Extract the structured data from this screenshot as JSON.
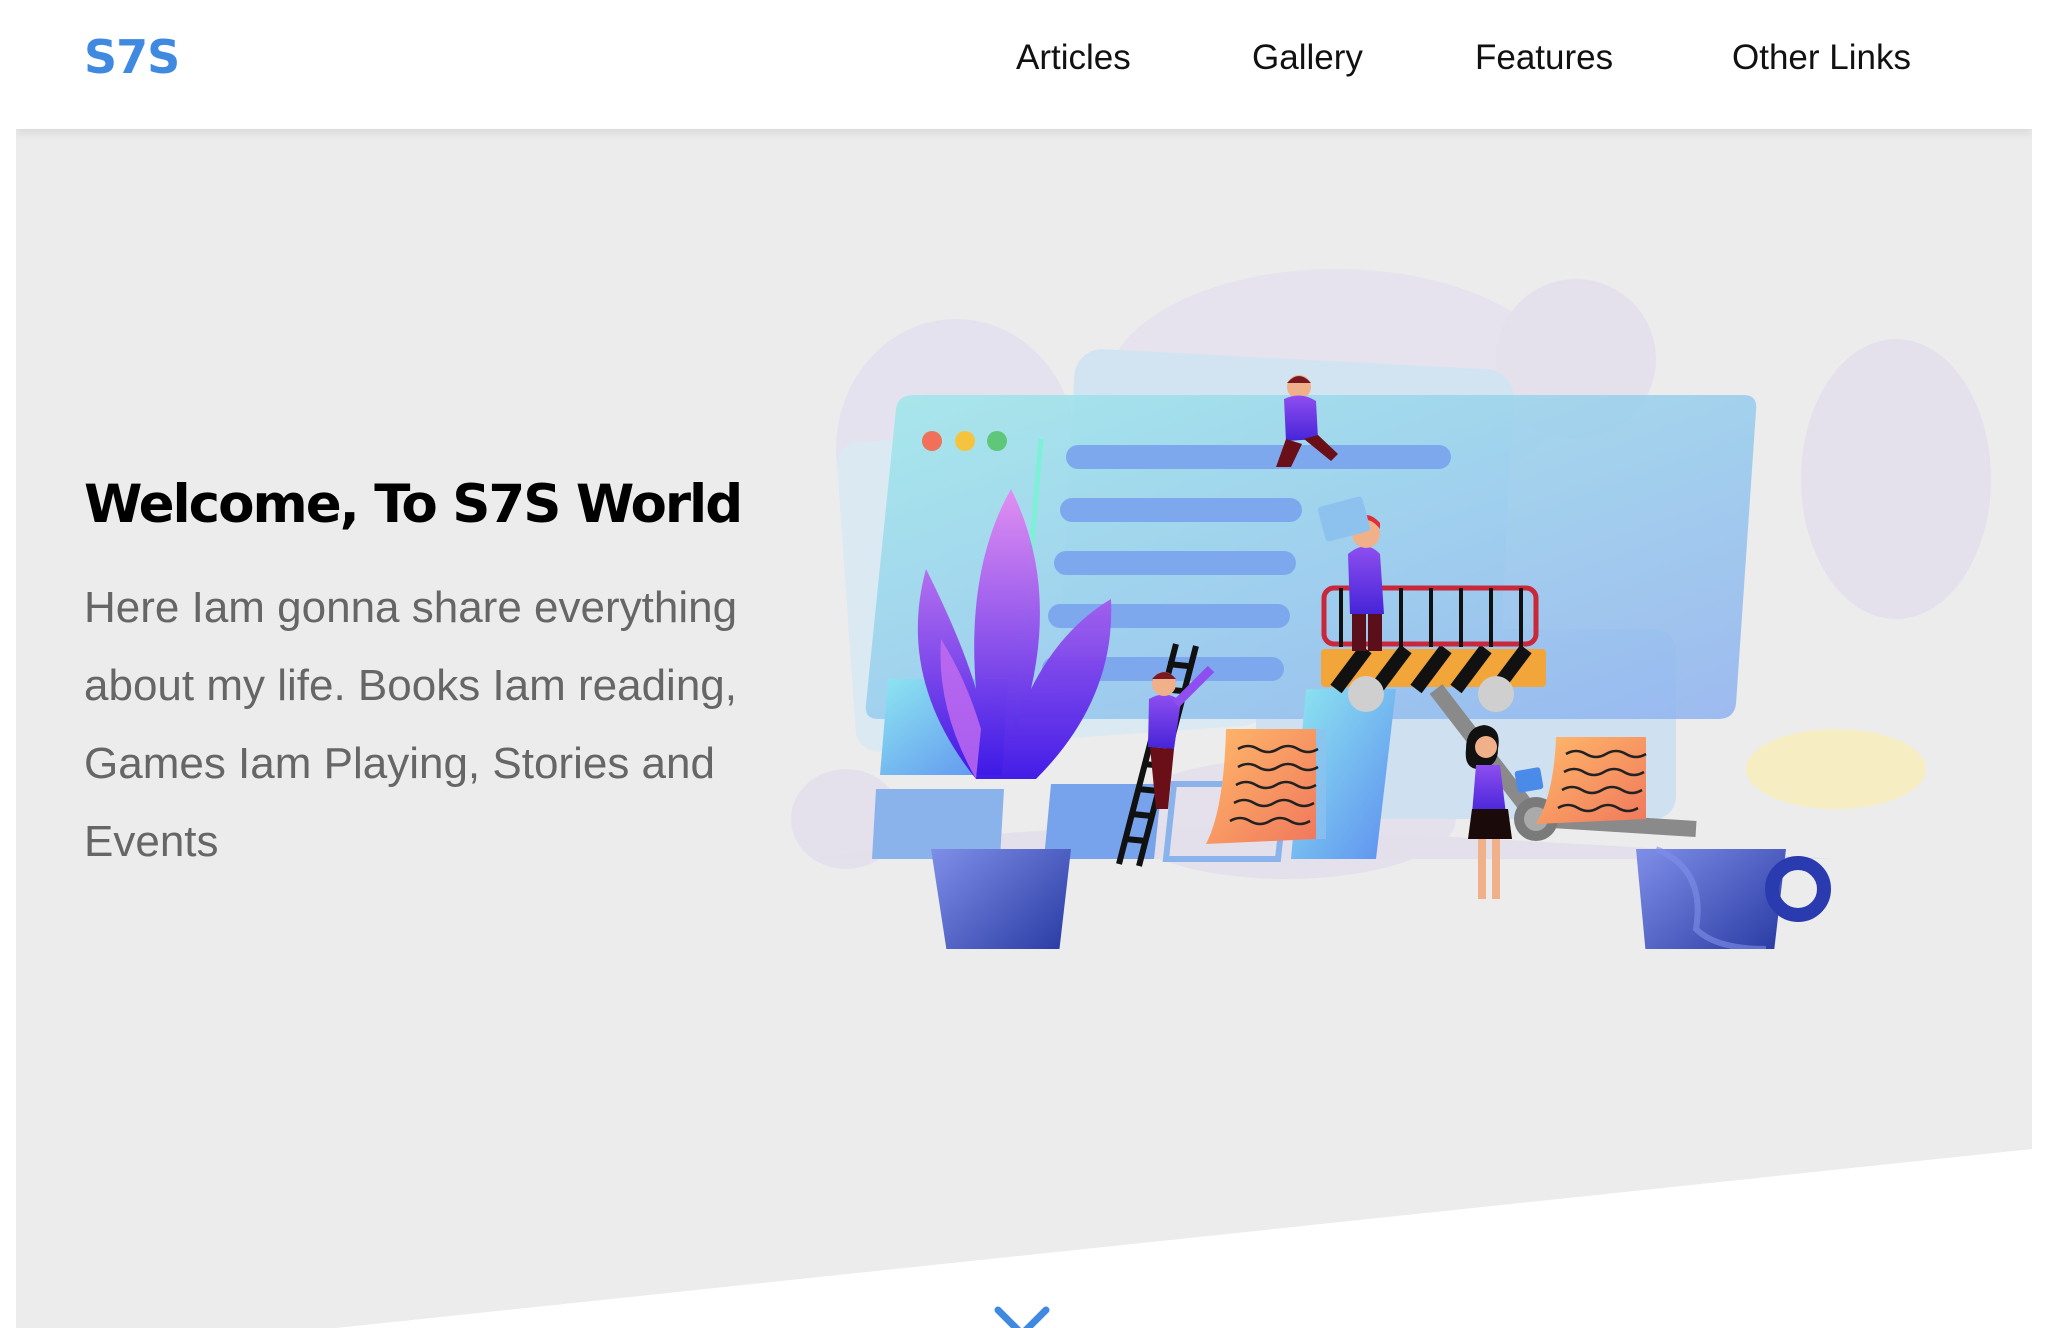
{
  "header": {
    "logo": "S7S",
    "nav": [
      {
        "label": "Articles"
      },
      {
        "label": "Gallery"
      },
      {
        "label": "Features"
      },
      {
        "label": "Other Links"
      }
    ]
  },
  "hero": {
    "title": "Welcome, To S7S World",
    "text": "Here Iam gonna share everything about my life. Books Iam reading, Games Iam Playing, Stories and Events",
    "illustration_icon": "website-building-illustration",
    "scroll_icon": "chevron-down-icon"
  },
  "colors": {
    "brand": "#3f8ae0",
    "hero_bg": "#ececec",
    "text_muted": "#666666",
    "accent_purple": "#5a2de8"
  }
}
